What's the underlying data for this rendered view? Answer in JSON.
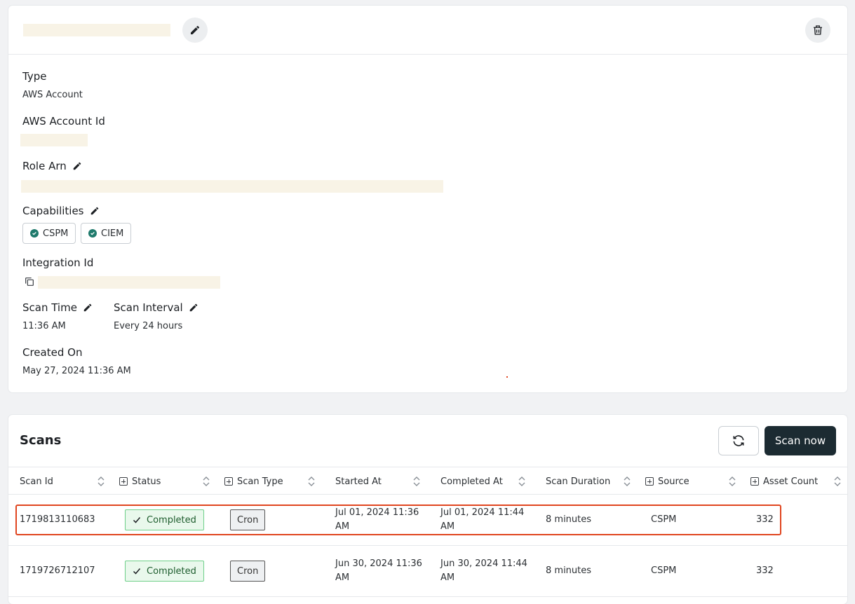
{
  "details": {
    "fields": {
      "type": {
        "label": "Type",
        "value": "AWS Account"
      },
      "aws_account_id": {
        "label": "AWS Account Id"
      },
      "role_arn": {
        "label": "Role Arn"
      },
      "capabilities": {
        "label": "Capabilities",
        "items": [
          "CSPM",
          "CIEM"
        ]
      },
      "integration_id": {
        "label": "Integration Id"
      },
      "scan_time": {
        "label": "Scan Time",
        "value": "11:36 AM"
      },
      "scan_interval": {
        "label": "Scan Interval",
        "value": "Every 24 hours"
      },
      "created_on": {
        "label": "Created On",
        "value": "May 27, 2024 11:36 AM"
      }
    }
  },
  "scans": {
    "title": "Scans",
    "scan_now_label": "Scan now",
    "columns": [
      "Scan Id",
      "Status",
      "Scan Type",
      "Started At",
      "Completed At",
      "Scan Duration",
      "Source",
      "Asset Count"
    ],
    "rows": [
      {
        "scan_id": "1719813110683",
        "status": "Completed",
        "scan_type": "Cron",
        "started_at_1": "Jul 01, 2024 11:36",
        "started_at_2": "AM",
        "completed_at_1": "Jul 01, 2024 11:44",
        "completed_at_2": "AM",
        "duration": "8 minutes",
        "source": "CSPM",
        "asset_count": "332"
      },
      {
        "scan_id": "1719726712107",
        "status": "Completed",
        "scan_type": "Cron",
        "started_at_1": "Jun 30, 2024 11:36",
        "started_at_2": "AM",
        "completed_at_1": "Jun 30, 2024 11:44",
        "completed_at_2": "AM",
        "duration": "8 minutes",
        "source": "CSPM",
        "asset_count": "332"
      }
    ]
  },
  "colors": {
    "accent_dark": "#1c2b32",
    "success": "#6fd08a",
    "highlight": "#e0451f",
    "check": "#1f7a6c"
  }
}
